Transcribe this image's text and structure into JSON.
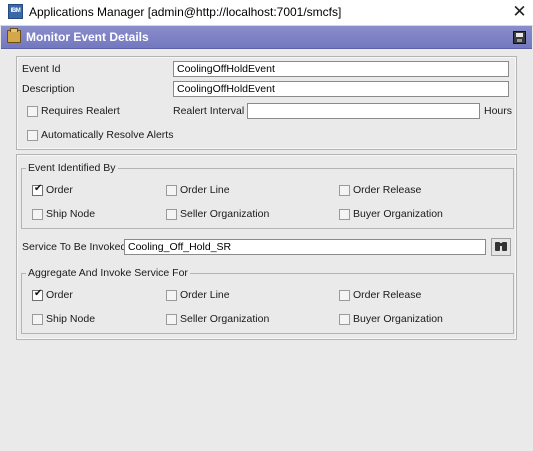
{
  "window": {
    "icon_text": "IBM",
    "title": "Applications Manager [admin@http://localhost:7001/smcfs]",
    "close_glyph": "✕"
  },
  "header": {
    "title": "Monitor Event Details",
    "left_icon": "briefcase-icon",
    "right_icon": "save-icon",
    "color": "#7b80c4"
  },
  "event": {
    "event_id_label": "Event Id",
    "event_id_value": "CoolingOffHoldEvent",
    "description_label": "Description",
    "description_value": "CoolingOffHoldEvent",
    "requires_realert_label": "Requires Realert",
    "requires_realert_checked": false,
    "realert_interval_label": "Realert Interval",
    "realert_interval_value": "",
    "hours_label": "Hours",
    "auto_resolve_label": "Automatically Resolve Alerts",
    "auto_resolve_checked": false
  },
  "identified_by": {
    "title": "Event Identified By",
    "options": [
      {
        "label": "Order",
        "checked": true
      },
      {
        "label": "Order Line",
        "checked": false
      },
      {
        "label": "Order Release",
        "checked": false
      },
      {
        "label": "Ship Node",
        "checked": false
      },
      {
        "label": "Seller Organization",
        "checked": false
      },
      {
        "label": "Buyer Organization",
        "checked": false
      }
    ]
  },
  "service": {
    "label": "Service To Be Invoked",
    "value": "Cooling_Off_Hold_SR",
    "lookup_icon": "binoculars-icon"
  },
  "aggregate": {
    "title": "Aggregate And Invoke Service For",
    "options": [
      {
        "label": "Order",
        "checked": true
      },
      {
        "label": "Order Line",
        "checked": false
      },
      {
        "label": "Order Release",
        "checked": false
      },
      {
        "label": "Ship Node",
        "checked": false
      },
      {
        "label": "Seller Organization",
        "checked": false
      },
      {
        "label": "Buyer Organization",
        "checked": false
      }
    ]
  }
}
